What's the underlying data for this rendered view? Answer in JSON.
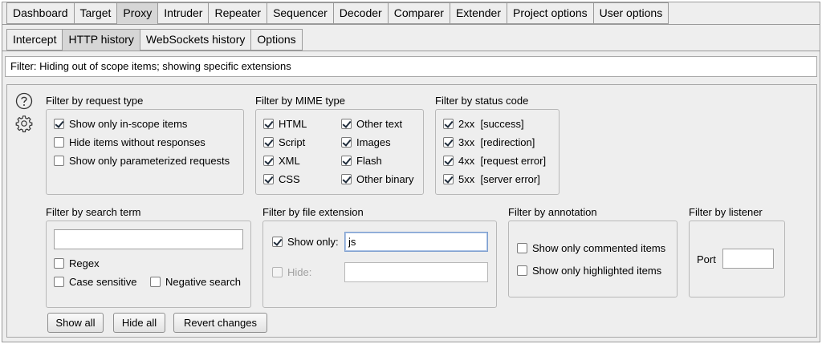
{
  "tabs_top": [
    "Dashboard",
    "Target",
    "Proxy",
    "Intruder",
    "Repeater",
    "Sequencer",
    "Decoder",
    "Comparer",
    "Extender",
    "Project options",
    "User options"
  ],
  "tabs_sub": [
    "Intercept",
    "HTTP history",
    "WebSockets history",
    "Options"
  ],
  "filter_bar": "Filter: Hiding out of scope items;  showing specific extensions",
  "request_type": {
    "title": "Filter by request type",
    "items": [
      {
        "label": "Show only in-scope items",
        "checked": true
      },
      {
        "label": "Hide items without responses",
        "checked": false
      },
      {
        "label": "Show only parameterized requests",
        "checked": false
      }
    ]
  },
  "mime_type": {
    "title": "Filter by MIME type",
    "items": [
      {
        "label": "HTML",
        "checked": true
      },
      {
        "label": "Other text",
        "checked": true
      },
      {
        "label": "Script",
        "checked": true
      },
      {
        "label": "Images",
        "checked": true
      },
      {
        "label": "XML",
        "checked": true
      },
      {
        "label": "Flash",
        "checked": true
      },
      {
        "label": "CSS",
        "checked": true
      },
      {
        "label": "Other binary",
        "checked": true
      }
    ]
  },
  "status_code": {
    "title": "Filter by status code",
    "items": [
      {
        "label": "2xx  [success]",
        "checked": true
      },
      {
        "label": "3xx  [redirection]",
        "checked": true
      },
      {
        "label": "4xx  [request error]",
        "checked": true
      },
      {
        "label": "5xx  [server error]",
        "checked": true
      }
    ]
  },
  "search_term": {
    "title": "Filter by search term",
    "value": "",
    "regex": "Regex",
    "case_sensitive": "Case sensitive",
    "negative": "Negative search"
  },
  "file_extension": {
    "title": "Filter by file extension",
    "show_only_label": "Show only:",
    "show_only_value": "js",
    "hide_label": "Hide:",
    "hide_value": ""
  },
  "annotation": {
    "title": "Filter by annotation",
    "commented": "Show only commented items",
    "highlighted": "Show only highlighted items"
  },
  "listener": {
    "title": "Filter by listener",
    "port_label": "Port",
    "port_value": ""
  },
  "buttons": {
    "show_all": "Show all",
    "hide_all": "Hide all",
    "revert": "Revert changes"
  },
  "active_top_tab": "Proxy",
  "active_sub_tab": "HTTP history"
}
